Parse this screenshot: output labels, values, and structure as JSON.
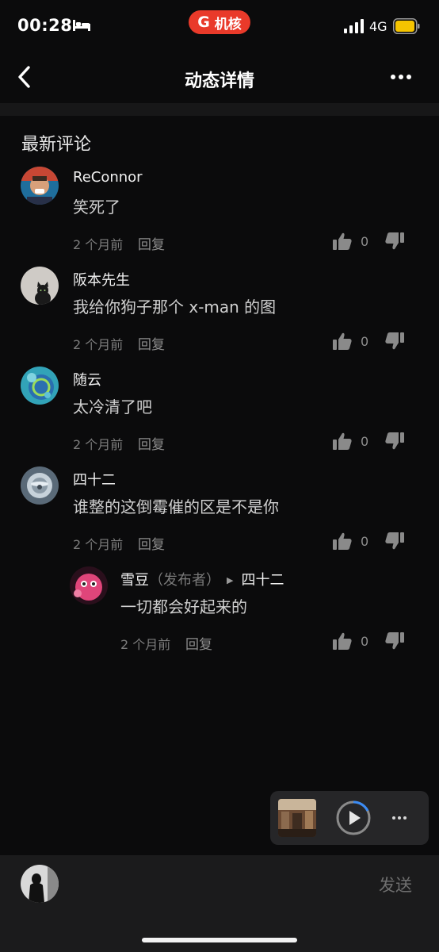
{
  "status": {
    "time": "00:28",
    "brand_letter": "G",
    "brand_name": "机核",
    "network": "4G"
  },
  "nav": {
    "title": "动态详情"
  },
  "section_title": "最新评论",
  "comments": [
    {
      "name": "ReConnor",
      "text": "笑死了",
      "time": "2 个月前",
      "reply": "回复",
      "likes": "0"
    },
    {
      "name": "阪本先生",
      "text": "我给你狗子那个 x-man 的图",
      "time": "2 个月前",
      "reply": "回复",
      "likes": "0"
    },
    {
      "name": "随云",
      "text": "太冷清了吧",
      "time": "2 个月前",
      "reply": "回复",
      "likes": "0"
    },
    {
      "name": "四十二",
      "text": "谁整的这倒霉催的区是不是你",
      "time": "2 个月前",
      "reply": "回复",
      "likes": "0"
    }
  ],
  "reply_comment": {
    "name": "雪豆",
    "publisher_tag": "（发布者）",
    "reply_to": "四十二",
    "text": "一切都会好起来的",
    "time": "2 个月前",
    "reply": "回复",
    "likes": "0"
  },
  "bottom": {
    "send_label": "发送"
  },
  "colors": {
    "background": "#0b0b0c",
    "brand_red": "#e93a2a",
    "battery_yellow": "#f5c400",
    "player_progress": "#3a8bf5"
  }
}
